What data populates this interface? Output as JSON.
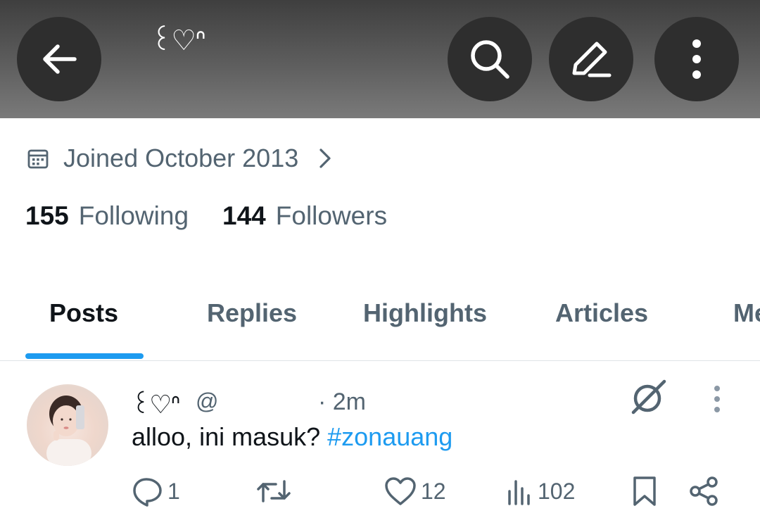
{
  "header": {
    "display_name": "꒰♡ᐢ",
    "icons": [
      "back-arrow-icon",
      "search-icon",
      "compose-icon",
      "more-vertical-icon"
    ]
  },
  "profile": {
    "joined_text": "Joined October 2013",
    "following_count": "155",
    "following_label": "Following",
    "followers_count": "144",
    "followers_label": "Followers"
  },
  "tabs": [
    {
      "label": "Posts",
      "active": true
    },
    {
      "label": "Replies",
      "active": false
    },
    {
      "label": "Highlights",
      "active": false
    },
    {
      "label": "Articles",
      "active": false
    },
    {
      "label": "Me",
      "active": false
    }
  ],
  "post": {
    "display_name": "꒰♡ᐢ",
    "handle": "@",
    "time": "· 2m",
    "text": "alloo, ini masuk? ",
    "hashtag": "#zonauang",
    "replies": "1",
    "reposts": "",
    "likes": "12",
    "views": "102"
  },
  "colors": {
    "accent": "#1d9bf0",
    "secondary_text": "#536471",
    "primary_text": "#0f1419",
    "header_button": "#2e2e2e"
  }
}
